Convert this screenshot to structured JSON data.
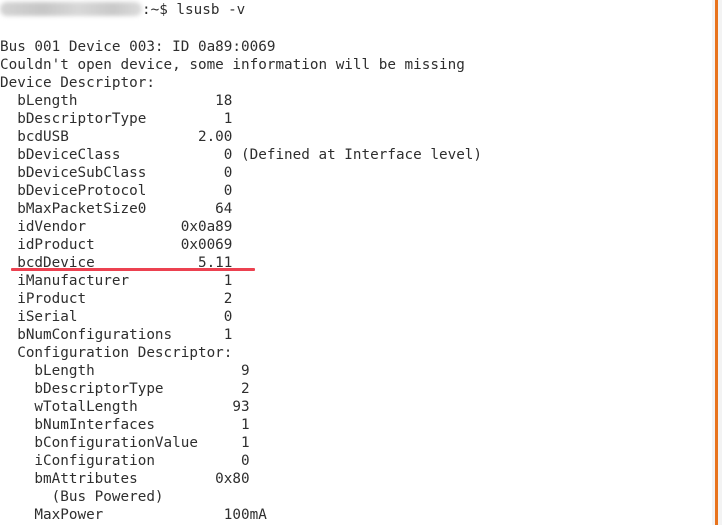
{
  "prompt": {
    "suffix": ":~$ lsusb -v"
  },
  "colors": {
    "text": "#2e2e2e",
    "background": "#ffffff",
    "scrollbar_thumb": "#e8731d",
    "highlight_underline": "#ec4150"
  },
  "lines": [
    "Bus 001 Device 003: ID 0a89:0069",
    "Couldn't open device, some information will be missing",
    "Device Descriptor:",
    "  bLength                18",
    "  bDescriptorType         1",
    "  bcdUSB               2.00",
    "  bDeviceClass            0 (Defined at Interface level)",
    "  bDeviceSubClass         0",
    "  bDeviceProtocol         0",
    "  bMaxPacketSize0        64",
    "  idVendor           0x0a89",
    "  idProduct          0x0069",
    "  bcdDevice            5.11",
    "  iManufacturer           1",
    "  iProduct                2",
    "  iSerial                 0",
    "  bNumConfigurations      1",
    "  Configuration Descriptor:",
    "    bLength                 9",
    "    bDescriptorType         2",
    "    wTotalLength           93",
    "    bNumInterfaces          1",
    "    bConfigurationValue     1",
    "    iConfiguration          0",
    "    bmAttributes         0x80",
    "      (Bus Powered)",
    "    MaxPower              100mA"
  ]
}
